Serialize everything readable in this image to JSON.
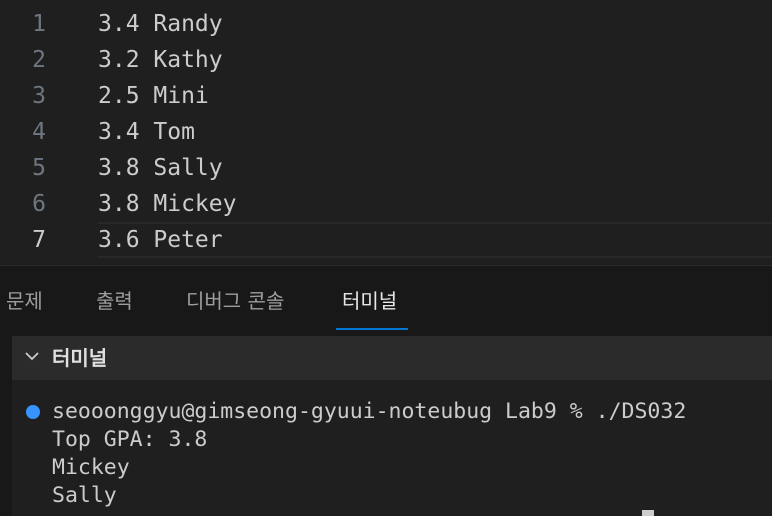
{
  "editor": {
    "lines": [
      {
        "num": "1",
        "text": "3.4 Randy"
      },
      {
        "num": "2",
        "text": "3.2 Kathy"
      },
      {
        "num": "3",
        "text": "2.5 Mini"
      },
      {
        "num": "4",
        "text": "3.4 Tom"
      },
      {
        "num": "5",
        "text": "3.8 Sally"
      },
      {
        "num": "6",
        "text": "3.8 Mickey"
      },
      {
        "num": "7",
        "text": "3.6 Peter"
      }
    ],
    "current_line": "7"
  },
  "panel": {
    "tabs": [
      {
        "label": "문제"
      },
      {
        "label": "출력"
      },
      {
        "label": "디버그 콘솔"
      },
      {
        "label": "터미널"
      }
    ],
    "active_tab": "터미널"
  },
  "terminal": {
    "title": "터미널",
    "prompt_command": "seooonggyu@gimseong-gyuui-noteubug Lab9 % ./DS032",
    "output": [
      "Top GPA: 3.8",
      "Mickey",
      "Sally"
    ],
    "prompt_dot_color": "#3794ff"
  },
  "colors": {
    "accent": "#0078d4"
  }
}
